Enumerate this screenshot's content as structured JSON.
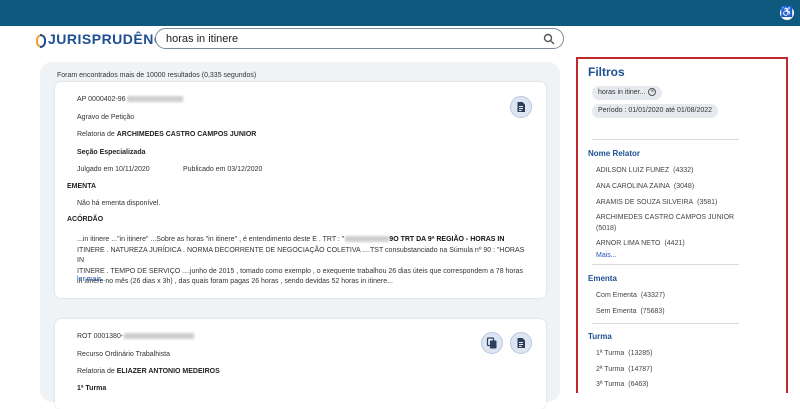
{
  "header": {
    "accessibility_icon": "accessibility-icon"
  },
  "logo": {
    "text": "JURISPRUDÊNCIA"
  },
  "search": {
    "value": "horas in itinere",
    "icon": "search-icon"
  },
  "results": {
    "count_text": "Foram encontrados mais de 10000 resultados (0,335 segundos)",
    "cards": [
      {
        "process": "AP 0000402-96",
        "type": "Agravo de Petição",
        "relator_prefix": "Relatoria de ",
        "relator": "ARCHIMEDES CASTRO CAMPOS JUNIOR",
        "section": "Seção Especializada",
        "judged": "Julgado em 10/11/2020",
        "published": "Publicado em 03/12/2020",
        "ementa_label": "EMENTA",
        "ementa_text": "Não há ementa disponível.",
        "acordao_label": "ACÓRDÃO",
        "snippet_lines": [
          "...in itinere ...\"in itinere\" ...Sobre as horas \"in itinere\" , é entendimento deste E . TRT : \"",
          "ITINERE . NATUREZA JURÍDICA . NORMA DECORRENTE DE NEGOCIAÇÃO COLETIVA ....TST consubstanciado na Súmula nº 90 : \"HORAS IN",
          "ITINERE . TEMPO DE SERVIÇO ....junho de 2015 , tomado como exemplo , o exequente trabalhou 26 dias úteis que correspondem a 78 horas",
          "in itinere no mês (26 dias x 3h) , das quais foram pagas 26 horas , sendo devidas 52 horas in itinere..."
        ],
        "snippet_tail": "9O TRT DA 9ª REGIÃO - HORAS IN",
        "read_more": "ler mais..."
      },
      {
        "process": "ROT 0001380-",
        "type": "Recurso Ordinário Trabalhista",
        "relator_prefix": "Relatoria de ",
        "relator": "ELIAZER ANTONIO MEDEIROS",
        "section": "1ª Turma"
      }
    ]
  },
  "filters": {
    "title": "Filtros",
    "chips": [
      {
        "label": "horas in itiner..."
      },
      {
        "label": "Período : 01/01/2020 até 01/08/2022"
      }
    ],
    "relator": {
      "heading": "Nome Relator",
      "items": [
        {
          "name": "ADILSON LUIZ FUNEZ",
          "count": "(4332)"
        },
        {
          "name": "ANA CAROLINA ZAINA",
          "count": "(3048)"
        },
        {
          "name": "ARAMIS DE SOUZA SILVEIRA",
          "count": "(3581)"
        },
        {
          "name": "ARCHIMEDES CASTRO CAMPOS JUNIOR",
          "count": "(5018)"
        },
        {
          "name": "ARNOR LIMA NETO",
          "count": "(4421)"
        }
      ],
      "more": "Mais..."
    },
    "ementa": {
      "heading": "Ementa",
      "items": [
        {
          "name": "Com Ementa",
          "count": "(43327)"
        },
        {
          "name": "Sem Ementa",
          "count": "(75683)"
        }
      ]
    },
    "turma": {
      "heading": "Turma",
      "items": [
        {
          "name": "1ª Turma",
          "count": "(13285)"
        },
        {
          "name": "2ª Turma",
          "count": "(14787)"
        },
        {
          "name": "3ª Turma",
          "count": "(6463)"
        }
      ]
    }
  },
  "colors": {
    "topbar": "#0e5a7e",
    "brand": "#1d4f91",
    "filter_border": "#c0282b",
    "link": "#2457b8"
  }
}
